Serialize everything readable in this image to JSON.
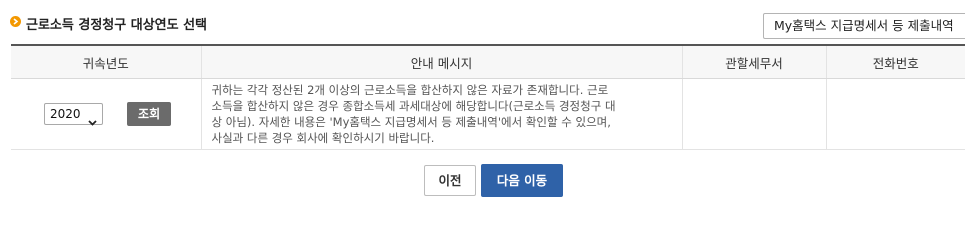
{
  "section": {
    "title": "근로소득 경정청구 대상연도 선택",
    "bullet_color": "#f39800",
    "icon": "chevron-right-circle-icon"
  },
  "header_button": {
    "label": "My홈택스 지급명세서 등 제출내역"
  },
  "table": {
    "columns": [
      "귀속년도",
      "안내 메시지",
      "관할세무서",
      "전화번호"
    ],
    "row": {
      "year_value": "2020",
      "search_label": "조회",
      "message_lines": [
        "귀하는 각각 정산된 2개 이상의 근로소득을 합산하지 않은 자료가 존재합니다. 근로",
        "소득을 합산하지 않은 경우 종합소득세 과세대상에 해당합니다(근로소득 경정청구 대",
        "상 아님). 자세한 내용은 'My홈택스 지급명세서 등 제출내역'에서 확인할 수 있으며,",
        "사실과 다른 경우 회사에 확인하시기 바랍니다."
      ],
      "tax_office": "",
      "phone": ""
    }
  },
  "footer": {
    "prev_label": "이전",
    "next_label": "다음 이동",
    "primary_color": "#2f62a8"
  }
}
